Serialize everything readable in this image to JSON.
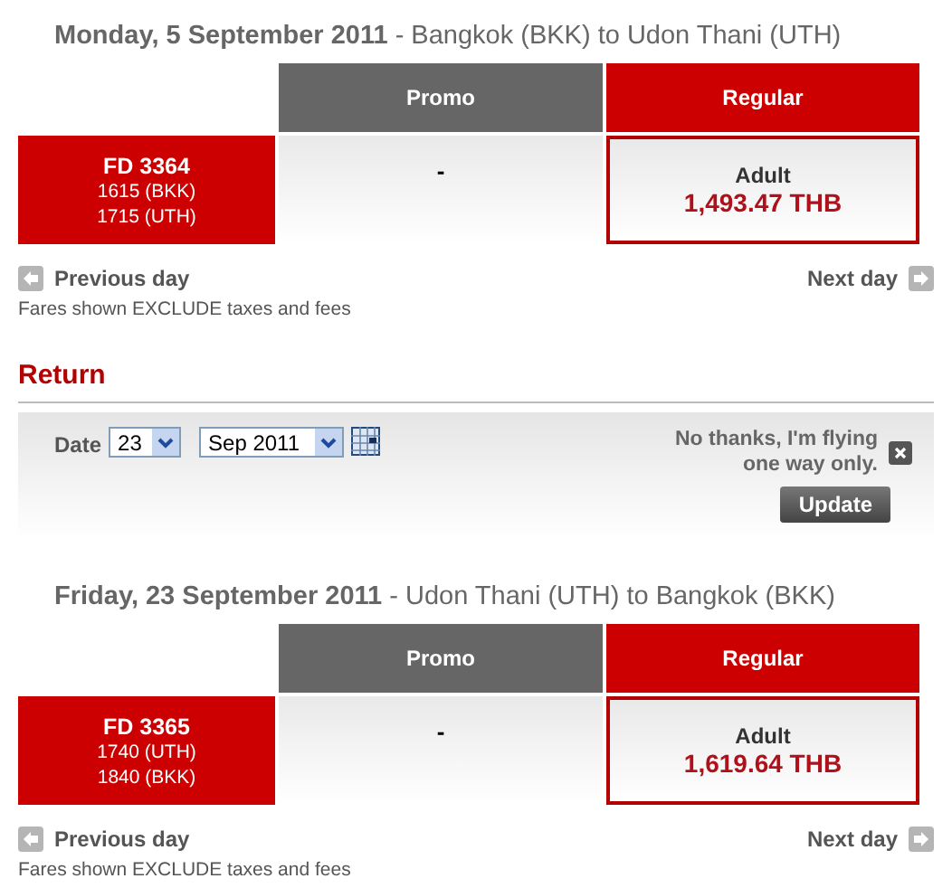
{
  "outbound": {
    "date": "Monday, 5 September 2011",
    "route": "- Bangkok (BKK)  to  Udon Thani (UTH)",
    "columns": [
      "Promo",
      "Regular"
    ],
    "flight": {
      "number": "FD  3364",
      "depart": "1615  (BKK)",
      "arrive": "1715  (UTH)"
    },
    "fares": [
      {
        "kind": "empty",
        "text": "-"
      },
      {
        "kind": "fare",
        "label": "Adult",
        "price": "1,493.47 THB",
        "selected": true
      }
    ],
    "previous": "Previous day",
    "next": "Next day",
    "note": "Fares shown EXCLUDE taxes and fees"
  },
  "return_heading": "Return",
  "return_panel": {
    "date_label": "Date",
    "day": "23",
    "month": "Sep 2011",
    "decline": "No thanks, I'm flying one way only.",
    "update": "Update"
  },
  "inbound": {
    "date": "Friday, 23 September 2011",
    "route": "- Udon Thani (UTH)  to  Bangkok (BKK)",
    "columns": [
      "Promo",
      "Regular"
    ],
    "flight": {
      "number": "FD  3365",
      "depart": "1740  (UTH)",
      "arrive": "1840  (BKK)"
    },
    "fares": [
      {
        "kind": "empty",
        "text": "-"
      },
      {
        "kind": "fare",
        "label": "Adult",
        "price": "1,619.64 THB",
        "selected": true
      }
    ],
    "previous": "Previous day",
    "next": "Next day",
    "note": "Fares shown EXCLUDE taxes and fees"
  }
}
